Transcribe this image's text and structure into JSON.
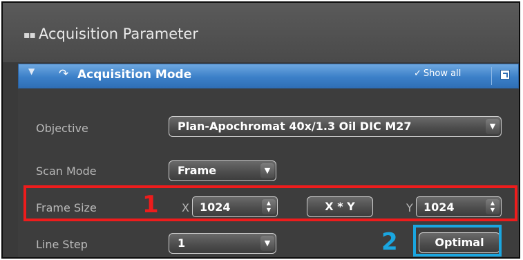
{
  "panel": {
    "grip_icon": "grip-dots",
    "title": "Acquisition Parameter"
  },
  "section": {
    "collapse_icon": "▼",
    "mode_icon": "↷",
    "title": "Acquisition Mode",
    "show_all_check": "✓",
    "show_all_label": "Show all",
    "popout_icon": "popout-window-icon"
  },
  "objective": {
    "label": "Objective",
    "value": "Plan-Apochromat 40x/1.3 Oil DIC M27"
  },
  "scan_mode": {
    "label": "Scan Mode",
    "value": "Frame"
  },
  "frame_size": {
    "label": "Frame Size",
    "x_label": "X",
    "x_value": "1024",
    "xy_button": "X * Y",
    "y_label": "Y",
    "y_value": "1024"
  },
  "line_step": {
    "label": "Line Step",
    "value": "1",
    "optimal_button": "Optimal"
  },
  "annotations": {
    "marker_1": "1",
    "marker_1_color": "#ee1c1c",
    "marker_2": "2",
    "marker_2_color": "#1aa6e0"
  },
  "colors": {
    "accent": "#3b7fc8",
    "background": "#3a3a3a"
  }
}
